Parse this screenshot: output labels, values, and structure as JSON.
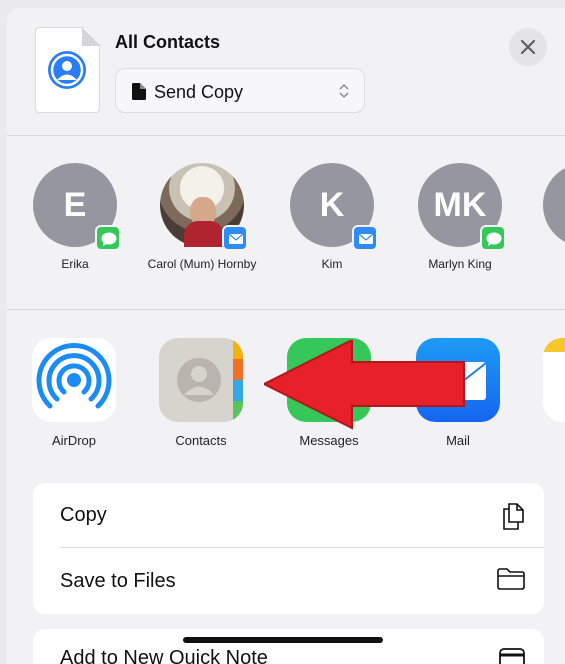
{
  "header": {
    "title": "All Contacts",
    "select_value": "Send Copy"
  },
  "people": [
    {
      "initials": "E",
      "name": "Erika",
      "badge": "messages"
    },
    {
      "initials": "",
      "name": "Carol (Mum) Hornby",
      "badge": "mail"
    },
    {
      "initials": "K",
      "name": "Kim",
      "badge": "mail"
    },
    {
      "initials": "MK",
      "name": "Marlyn King",
      "badge": "messages"
    }
  ],
  "apps": [
    {
      "name": "AirDrop"
    },
    {
      "name": "Contacts"
    },
    {
      "name": "Messages"
    },
    {
      "name": "Mail"
    }
  ],
  "actions": [
    {
      "label": "Copy",
      "icon": "copy-icon"
    },
    {
      "label": "Save to Files",
      "icon": "folder-icon"
    },
    {
      "label": "Add to New Quick Note",
      "icon": "quick-note-icon"
    }
  ],
  "colors": {
    "avatar_gray": "#9596a0",
    "messages_green": "#35c759",
    "mail_blue": "#2f8cf5",
    "annotation_arrow": "#e8202a"
  }
}
